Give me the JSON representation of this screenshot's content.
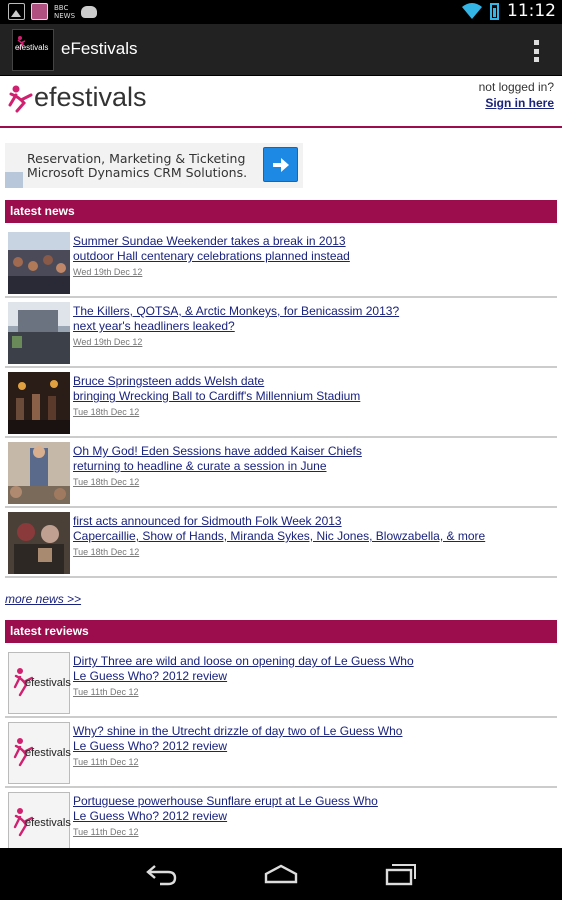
{
  "status_bar": {
    "notification_icons": [
      "gallery-icon",
      "efestivals-app-icon",
      "bbc-news-icon",
      "android-cat-icon"
    ],
    "news_label_line1": "BBC",
    "news_label_line2": "NEWS",
    "time": "11:12"
  },
  "action_bar": {
    "logo_text": "efestivals",
    "title": "eFestivals"
  },
  "header": {
    "brand": "efestivals",
    "login_status": "not logged in?",
    "sign_in": "Sign in here"
  },
  "ad": {
    "line1": "Reservation, Marketing & Ticketing",
    "line2": "Microsoft Dynamics CRM Solutions."
  },
  "latest_news": {
    "title": "latest news",
    "items": [
      {
        "headline": "Summer Sundae Weekender takes a break in 2013",
        "subline": "outdoor Hall centenary celebrations planned instead",
        "date": "Wed 19th Dec 12"
      },
      {
        "headline": "The Killers, QOTSA, & Arctic Monkeys, for Benicassim 2013?",
        "subline": "next year's headliners leaked?",
        "date": "Wed 19th Dec 12"
      },
      {
        "headline": "Bruce Springsteen adds Welsh date",
        "subline": "bringing Wrecking Ball to Cardiff's Millennium Stadium",
        "date": "Tue 18th Dec 12"
      },
      {
        "headline": "Oh My God! Eden Sessions have added Kaiser Chiefs",
        "subline": "returning to headline & curate a session in June",
        "date": "Tue 18th Dec 12"
      },
      {
        "headline": "first acts announced for Sidmouth Folk Week 2013",
        "subline": "Capercaillie, Show of Hands, Miranda Sykes, Nic Jones, Blowzabella, & more",
        "date": "Tue 18th Dec 12"
      }
    ],
    "more": "more news >>"
  },
  "latest_reviews": {
    "title": "latest reviews",
    "thumb_text": "efestivals",
    "items": [
      {
        "headline": "Dirty Three are wild and loose on opening day of Le Guess Who",
        "subline": "Le Guess Who? 2012 review",
        "date": "Tue 11th Dec 12"
      },
      {
        "headline": "Why? shine in the Utrecht drizzle of day two of Le Guess Who",
        "subline": "Le Guess Who? 2012 review",
        "date": "Tue 11th Dec 12"
      },
      {
        "headline": "Portuguese powerhouse Sunflare erupt at Le Guess Who",
        "subline": "Le Guess Who? 2012 review",
        "date": "Tue 11th Dec 12"
      }
    ]
  },
  "nav_bar": {
    "buttons": [
      "back-icon",
      "home-icon",
      "recent-apps-icon"
    ]
  },
  "colors": {
    "accent": "#9b0d4c",
    "link": "#1a237e",
    "status_blue": "#33b5e5"
  }
}
